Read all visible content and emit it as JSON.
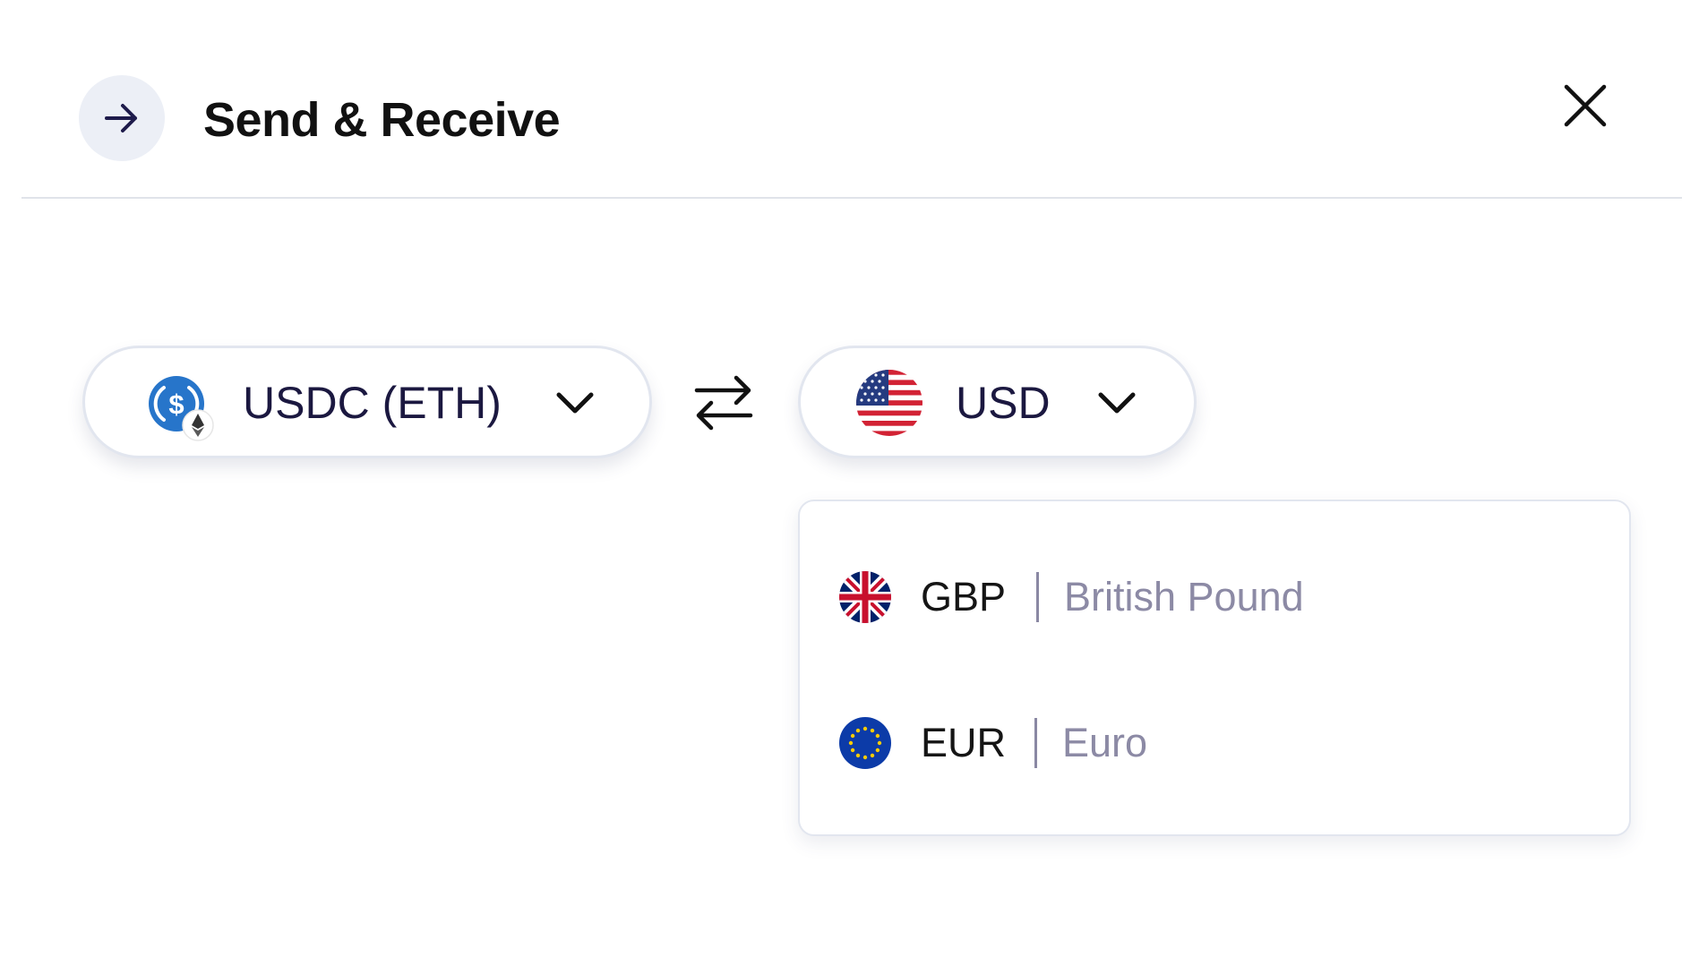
{
  "header": {
    "title": "Send & Receive",
    "icon": "arrow-right-icon",
    "close_icon": "close-icon"
  },
  "converter": {
    "from": {
      "label": "USDC (ETH)",
      "icon": "usdc-eth-icon"
    },
    "swap_icon": "swap-arrows-icon",
    "to": {
      "label": "USD",
      "icon": "us-flag-icon"
    }
  },
  "currency_dropdown": {
    "options": [
      {
        "code": "GBP",
        "name": "British Pound",
        "icon": "uk-flag-icon"
      },
      {
        "code": "EUR",
        "name": "Euro",
        "icon": "eu-flag-icon"
      }
    ]
  },
  "colors": {
    "accent_text": "#1b1840",
    "muted_text": "#8c8aa5",
    "usdc_blue": "#2775ca",
    "border": "#e2e6ef"
  }
}
